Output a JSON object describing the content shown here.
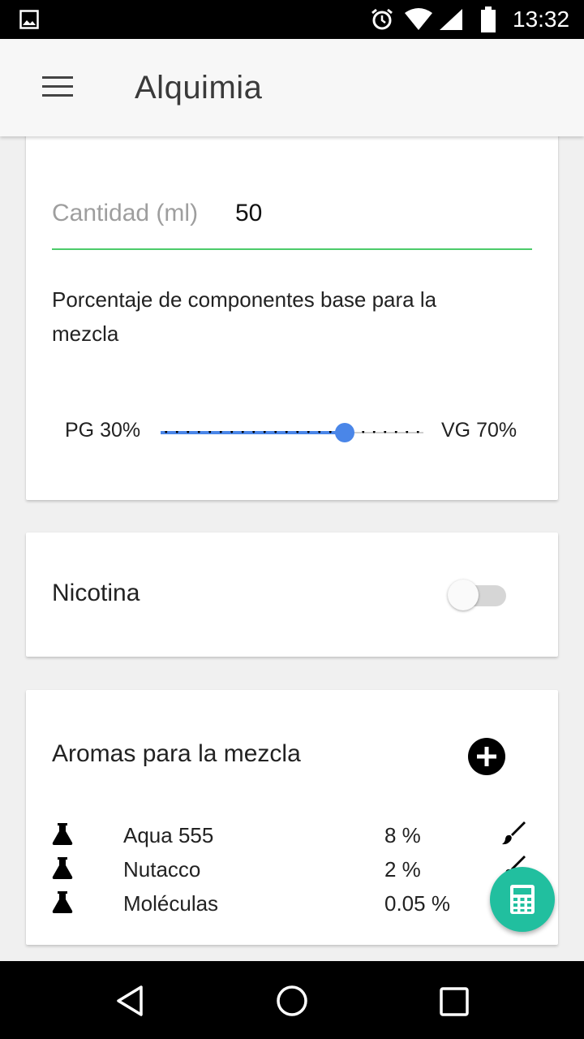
{
  "status_bar": {
    "time": "13:32",
    "icons": [
      "gallery-icon",
      "alarm-icon",
      "wifi-icon",
      "signal-icon",
      "battery-icon"
    ]
  },
  "app_bar": {
    "title": "Alquimia",
    "menu_icon": "menu-icon"
  },
  "base_card": {
    "quantity_label": "Cantidad (ml)",
    "quantity_value": "50",
    "description": "Porcentaje de componentes base para la mezcla",
    "pg_label": "PG 30%",
    "vg_label": "VG 70%",
    "slider_vg_fraction": 0.7,
    "accent_color": "#4a86e8",
    "input_underline_color": "#4ccb6a"
  },
  "nicotine_card": {
    "label": "Nicotina",
    "enabled": false
  },
  "aromas_card": {
    "title": "Aromas para la mezcla",
    "add_icon": "add-circle-icon",
    "items": [
      {
        "name": "Aqua 555",
        "percent": "8 %"
      },
      {
        "name": "Nutacco",
        "percent": "2 %"
      },
      {
        "name": "Moléculas",
        "percent": "0.05 %"
      }
    ]
  },
  "fab": {
    "icon": "calculator-icon",
    "color": "#21bf9f"
  },
  "nav_bar": {
    "icons": [
      "back-icon",
      "home-icon",
      "recents-icon"
    ]
  }
}
